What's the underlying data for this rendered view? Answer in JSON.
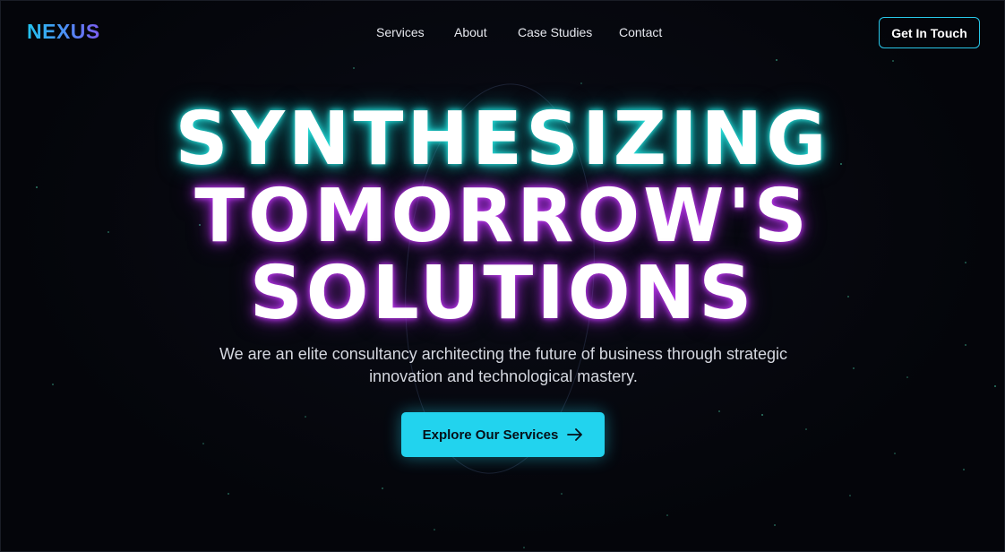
{
  "nav": {
    "logo": "NEXUS",
    "links": [
      "Services",
      "About",
      "Case Studies",
      "Contact"
    ],
    "cta_label": "Get In Touch"
  },
  "hero": {
    "headline_lines": [
      "SYNTHESIZING",
      "TOMORROW'S",
      "SOLUTIONS"
    ],
    "subtext_line1": "We are an elite consultancy architecting the future of business through strategic",
    "subtext_line2": "innovation and technological mastery.",
    "cta_label": "Explore Our Services",
    "cta_icon": "arrow-right-icon"
  },
  "colors": {
    "accent_cyan": "#22d3ee",
    "glow_teal": "#16c9c9",
    "glow_purple": "#a02ad8",
    "background": "#05060b"
  }
}
